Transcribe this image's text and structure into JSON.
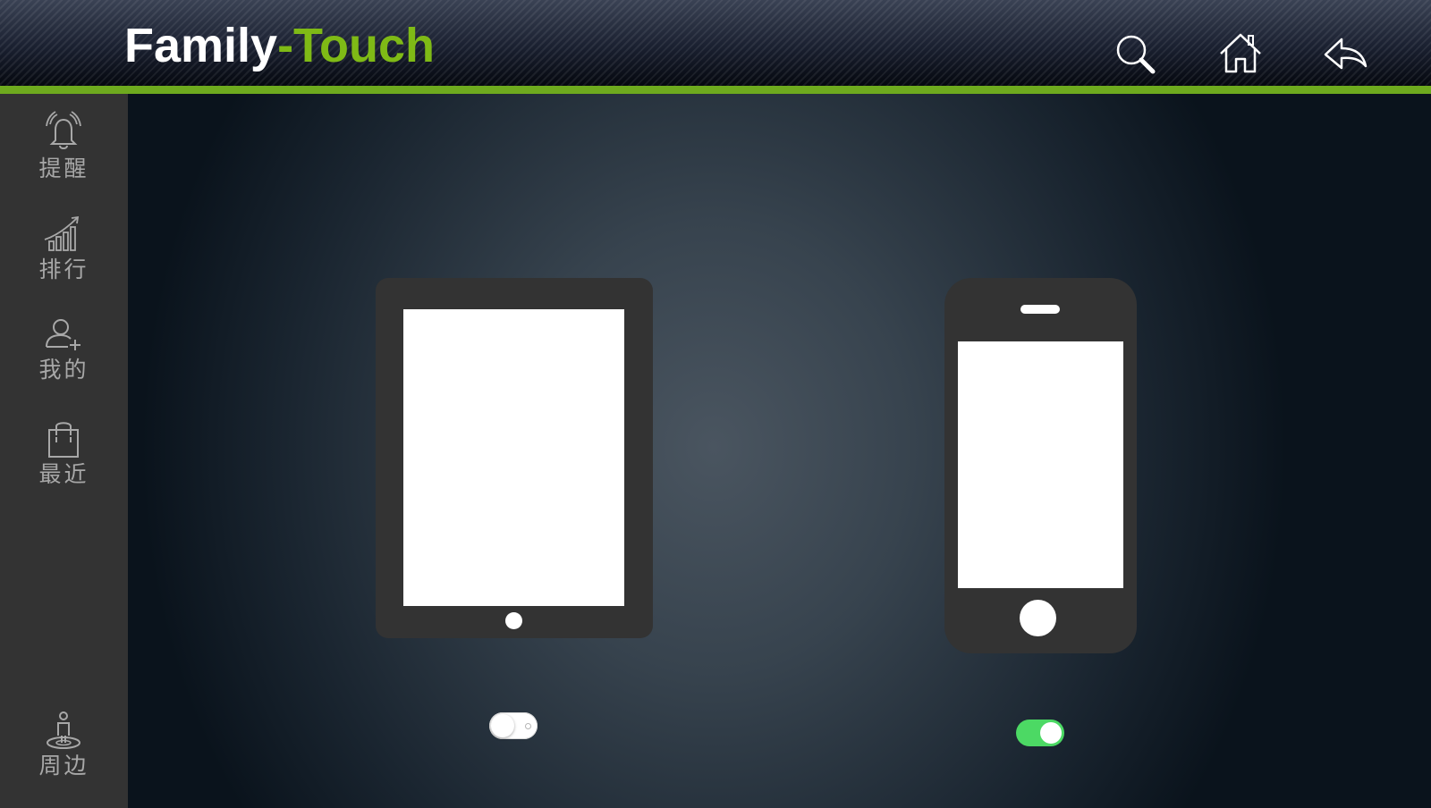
{
  "app": {
    "title_part1": "Family",
    "title_part2": "-Touch"
  },
  "header_icons": [
    "search-icon",
    "home-icon",
    "back-arrow-icon"
  ],
  "sidebar": {
    "items": [
      {
        "label": "提醒",
        "icon": "bell-icon"
      },
      {
        "label": "排行",
        "icon": "ranking-chart-icon"
      },
      {
        "label": "我的",
        "icon": "user-add-icon"
      },
      {
        "label": "最近",
        "icon": "shopping-bag-icon"
      },
      {
        "label": "周边",
        "icon": "location-person-icon"
      }
    ]
  },
  "devices": [
    {
      "type": "tablet",
      "toggle_on": false
    },
    {
      "type": "phone",
      "toggle_on": true
    }
  ],
  "colors": {
    "accent_green": "#7fba16",
    "bar_green": "#6eaa1e",
    "toggle_on": "#4cd964",
    "sidebar_bg": "#333333"
  }
}
